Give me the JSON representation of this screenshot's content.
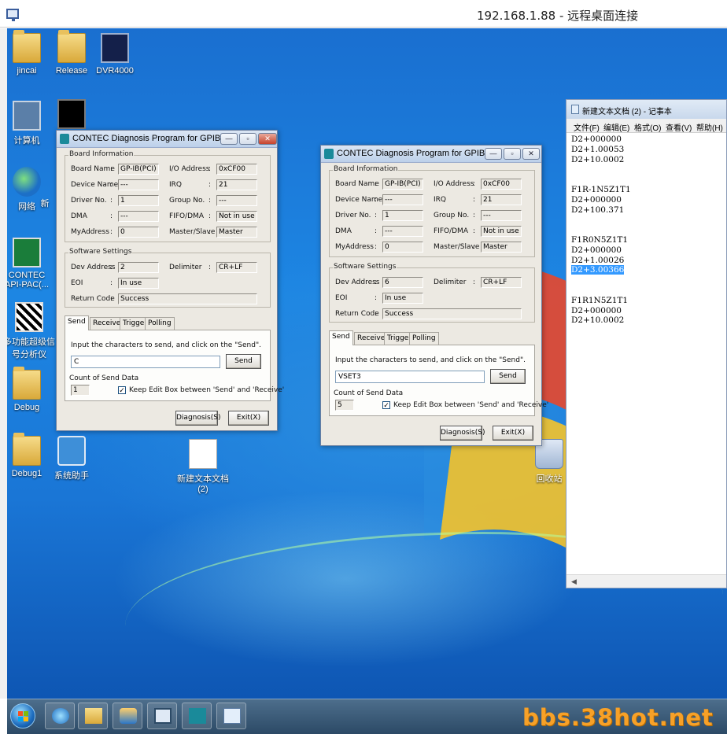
{
  "rdp": {
    "title": "192.168.1.88 - 远程桌面连接"
  },
  "desktop_icons": [
    {
      "label": "jincai"
    },
    {
      "label": "Release"
    },
    {
      "label": "DVR4000"
    },
    {
      "label": "计算机"
    },
    {
      "label": "网络"
    },
    {
      "label": "CONTEC API-PAC(..."
    },
    {
      "label": "多功能超级信号分析仪"
    },
    {
      "label": "Debug"
    },
    {
      "label": "Debug1"
    },
    {
      "label": "系统助手"
    },
    {
      "label": "新建文本文档 (2)"
    },
    {
      "label": "回收站"
    },
    {
      "label": "新"
    }
  ],
  "dialog1": {
    "title": "CONTEC Diagnosis Program for GPIB Com...",
    "board_info": {
      "group": "Board Information",
      "board_name_label": "Board Name",
      "board_name": "GP-IB(PCI)",
      "io_label": "I/O Address",
      "io": "0xCF00",
      "device_label": "Device Name",
      "device": "---",
      "irq_label": "IRQ",
      "irq": "21",
      "driver_label": "Driver No.",
      "driver": "1",
      "group_no_label": "Group No.",
      "group_no": "---",
      "dma_label": "DMA",
      "dma": "---",
      "fifo_label": "FIFO/DMA",
      "fifo": "Not in use",
      "myaddr_label": "MyAddress",
      "myaddr": "0",
      "ms_label": "Master/Slave",
      "ms": "Master"
    },
    "software": {
      "group": "Software Settings",
      "dev_label": "Dev Address",
      "dev": "2",
      "delim_label": "Delimiter",
      "delim": "CR+LF",
      "eoi_label": "EOI",
      "eoi": "In use",
      "ret_label": "Return Code",
      "ret": "Success"
    },
    "tabs": [
      "Send",
      "Receive",
      "Trigger",
      "Polling"
    ],
    "send": {
      "instruction": "Input the characters to send, and click on the \"Send\".",
      "value": "C",
      "send_button": "Send",
      "count_label": "Count of Send Data",
      "count": "1",
      "keep_label": "Keep Edit Box between 'Send' and 'Receive'",
      "keep_checked": "✓"
    },
    "diagnosis_button": "Diagnosis(S)",
    "exit_button": "Exit(X)"
  },
  "dialog2": {
    "title": "CONTEC Diagnosis Program for GPIB Com...",
    "board_info": {
      "group": "Board Information",
      "board_name_label": "Board Name",
      "board_name": "GP-IB(PCI)",
      "io_label": "I/O Address",
      "io": "0xCF00",
      "device_label": "Device Name",
      "device": "---",
      "irq_label": "IRQ",
      "irq": "21",
      "driver_label": "Driver No.",
      "driver": "1",
      "group_no_label": "Group No.",
      "group_no": "---",
      "dma_label": "DMA",
      "dma": "---",
      "fifo_label": "FIFO/DMA",
      "fifo": "Not in use",
      "myaddr_label": "MyAddress",
      "myaddr": "0",
      "ms_label": "Master/Slave",
      "ms": "Master"
    },
    "software": {
      "group": "Software Settings",
      "dev_label": "Dev Address",
      "dev": "6",
      "delim_label": "Delimiter",
      "delim": "CR+LF",
      "eoi_label": "EOI",
      "eoi": "In use",
      "ret_label": "Return Code",
      "ret": "Success"
    },
    "tabs": [
      "Send",
      "Receive",
      "Trigger",
      "Polling"
    ],
    "send": {
      "instruction": "Input the characters to send, and click on the \"Send\".",
      "value": "VSET3",
      "send_button": "Send",
      "count_label": "Count of Send Data",
      "count": "5",
      "keep_label": "Keep Edit Box between 'Send' and 'Receive'",
      "keep_checked": "✓"
    },
    "diagnosis_button": "Diagnosis(S)",
    "exit_button": "Exit(X)"
  },
  "notepad": {
    "title": "新建文本文档 (2) - 记事本",
    "menu": [
      "文件(F)",
      "编辑(E)",
      "格式(O)",
      "查看(V)",
      "帮助(H)"
    ],
    "lines": [
      "D2+000000",
      "D2+1.00053",
      "D2+10.0002",
      "",
      "",
      "F1R-1N5Z1T1",
      "D2+000000",
      "D2+100.371",
      "",
      "",
      "F1R0N5Z1T1",
      "D2+000000",
      "D2+1.00026",
      "D2+3.00366",
      "",
      "",
      "F1R1N5Z1T1",
      "D2+000000",
      "D2+10.0002"
    ],
    "selected_line": "D2+3.00366"
  },
  "watermark": "bbs.38hot.net",
  "colors": {
    "desktop": "#1d86e3",
    "selection": "#3399ff",
    "watermark": "#f7a128"
  }
}
